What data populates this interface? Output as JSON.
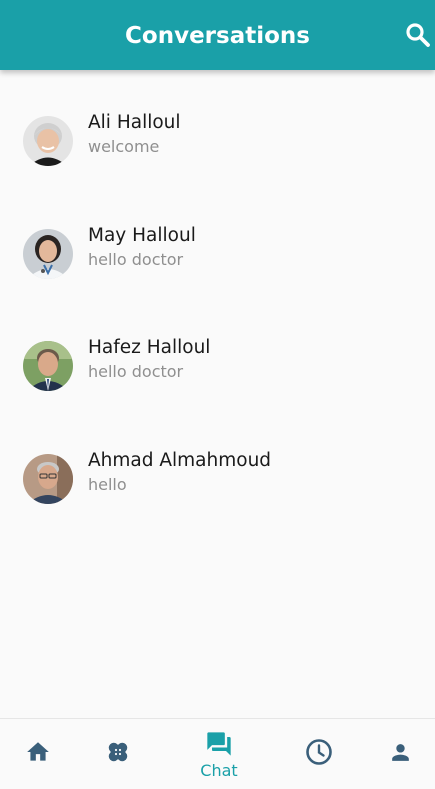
{
  "header": {
    "title": "Conversations",
    "search_icon": "search-icon"
  },
  "conversations": [
    {
      "name": "Ali Halloul",
      "last_message": "welcome",
      "avatar": "avatar-photo"
    },
    {
      "name": "May Halloul",
      "last_message": "hello doctor",
      "avatar": "avatar-photo"
    },
    {
      "name": "Hafez Halloul",
      "last_message": "hello doctor",
      "avatar": "avatar-photo"
    },
    {
      "name": "Ahmad Almahmoud",
      "last_message": "hello",
      "avatar": "avatar-photo"
    }
  ],
  "bottom_nav": {
    "items": [
      {
        "id": "home",
        "icon": "home-icon",
        "label": ""
      },
      {
        "id": "treatment",
        "icon": "bandage-icon",
        "label": ""
      },
      {
        "id": "chat",
        "icon": "forum-icon",
        "label": "Chat",
        "active": true
      },
      {
        "id": "history",
        "icon": "clock-icon",
        "label": ""
      },
      {
        "id": "profile",
        "icon": "person-icon",
        "label": ""
      }
    ]
  },
  "colors": {
    "primary": "#1aa0a8",
    "icon_inactive": "#3a5f7a",
    "background": "#fafafa",
    "subtitle": "#8f8f8f"
  }
}
